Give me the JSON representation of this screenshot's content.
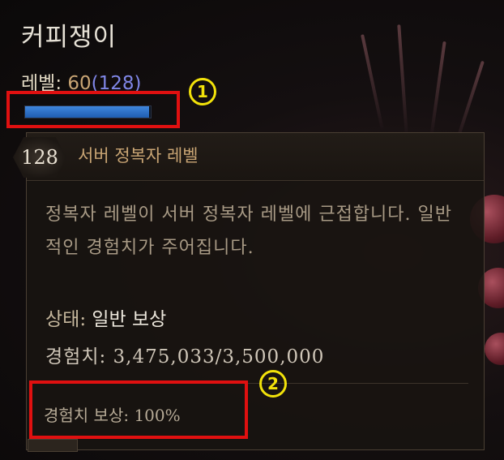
{
  "character": {
    "name": "커피쟁이"
  },
  "level": {
    "label": "레벨:",
    "value": "60",
    "paragon": "(128)",
    "xp_bar_fraction": 0.99
  },
  "callouts": {
    "one": "1",
    "two": "2"
  },
  "tooltip": {
    "paragon_level": "128",
    "title": "서버 정복자 레벨",
    "description": "정복자 레벨이 서버 정복자 레벨에 근접합니다. 일반적인 경험치가 주어집니다.",
    "status_label": "상태:",
    "status_value": "일반 보상",
    "xp_text": "경험치: 3,475,033/3,500,000",
    "reward_text": "경험치 보상: 100%"
  },
  "colors": {
    "highlight": "#e01010",
    "callout": "#f2e20a",
    "title_gold": "#c9a574",
    "paragon_blue": "#7f86e6",
    "xp_bar": "#2f74cc"
  }
}
